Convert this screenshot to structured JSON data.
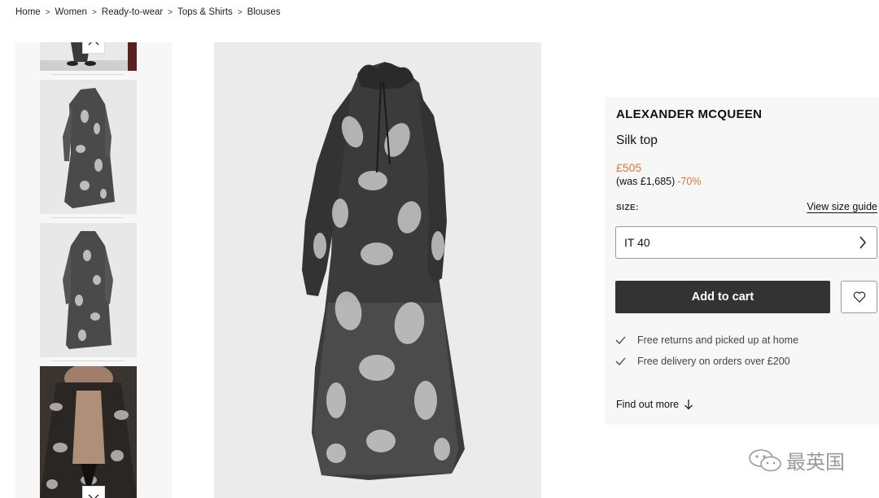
{
  "breadcrumb": [
    "Home",
    "Women",
    "Ready-to-wear",
    "Tops & Shirts",
    "Blouses"
  ],
  "product": {
    "brand": "ALEXANDER MCQUEEN",
    "name": "Silk top",
    "price": "£505",
    "was_price": "(was £1,685)",
    "discount": "-70%",
    "size_label": "SIZE:",
    "size_guide": "View size guide",
    "selected_size": "IT 40",
    "add_to_cart": "Add to cart",
    "benefits": [
      "Free returns and picked up at home",
      "Free delivery on orders over £200"
    ],
    "find_out_more": "Find out more"
  },
  "watermark": "最英国",
  "icons": [
    "chevron-up-icon",
    "chevron-down-icon",
    "chevron-right-icon",
    "heart-icon",
    "check-icon",
    "arrow-down-icon",
    "wechat-icon"
  ],
  "colors": {
    "accent_price": "#e0733a",
    "button_dark": "#333333",
    "panel_bg": "#f7f7f7"
  }
}
